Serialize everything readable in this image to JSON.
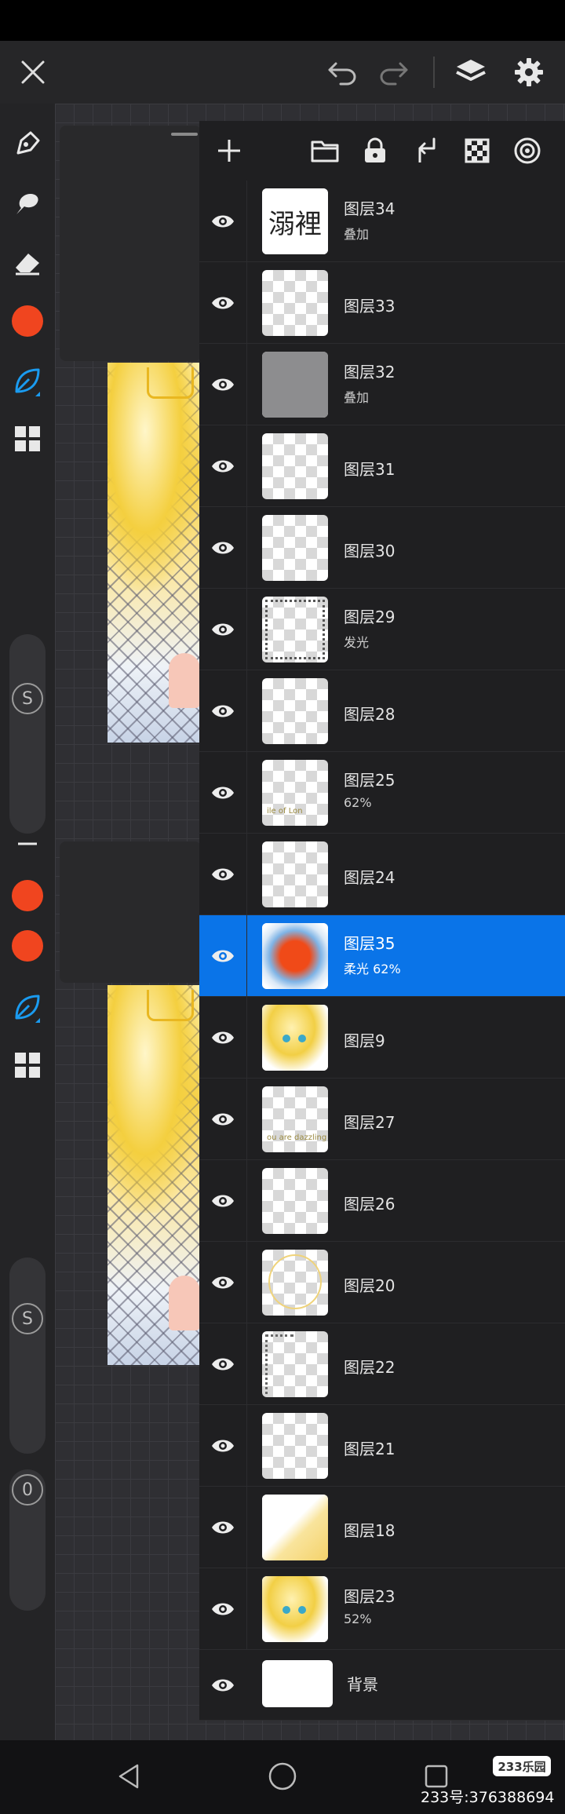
{
  "colors": {
    "accent": "#0a74e8",
    "brush_color": "#f0451f",
    "panel_bg": "#1f1f21",
    "toolbar_bg": "#242426"
  },
  "top_bar": {
    "icons": [
      "close-icon",
      "undo-icon",
      "redo-icon",
      "layers-icon",
      "settings-icon"
    ]
  },
  "toolbar": {
    "icons": [
      "pen-icon",
      "smudge-icon",
      "eraser-icon",
      "color-swatch",
      "brush-leaf-icon",
      "grid-icon"
    ],
    "slider_labels": [
      "S",
      "S",
      "0"
    ]
  },
  "layers_panel": {
    "header_icons": [
      "add-icon",
      "folder-icon",
      "lock-icon",
      "merge-down-icon",
      "checker-icon",
      "target-icon"
    ],
    "layers": [
      {
        "name": "图层34",
        "mode": "叠加",
        "thumb": "text",
        "thumb_text": "溺裡"
      },
      {
        "name": "图层33",
        "mode": "",
        "thumb": "empty"
      },
      {
        "name": "图层32",
        "mode": "叠加",
        "thumb": "grey"
      },
      {
        "name": "图层31",
        "mode": "",
        "thumb": "empty"
      },
      {
        "name": "图层30",
        "mode": "",
        "thumb": "empty"
      },
      {
        "name": "图层29",
        "mode": "发光",
        "thumb": "noise"
      },
      {
        "name": "图层28",
        "mode": "",
        "thumb": "empty"
      },
      {
        "name": "图层25",
        "mode": "62%",
        "thumb": "scribble",
        "thumb_text": "ile of Lon"
      },
      {
        "name": "图层24",
        "mode": "",
        "thumb": "empty"
      },
      {
        "name": "图层35",
        "mode": "柔光  62%",
        "thumb": "glow",
        "selected": true
      },
      {
        "name": "图层9",
        "mode": "",
        "thumb": "char"
      },
      {
        "name": "图层27",
        "mode": "",
        "thumb": "scribble",
        "thumb_text": "ou are dazzling"
      },
      {
        "name": "图层26",
        "mode": "",
        "thumb": "empty"
      },
      {
        "name": "图层20",
        "mode": "",
        "thumb": "ring"
      },
      {
        "name": "图层22",
        "mode": "",
        "thumb": "side"
      },
      {
        "name": "图层21",
        "mode": "",
        "thumb": "empty"
      },
      {
        "name": "图层18",
        "mode": "",
        "thumb": "yellow"
      },
      {
        "name": "图层23",
        "mode": "52%",
        "thumb": "char"
      }
    ],
    "background_layer": {
      "name": "背景"
    }
  },
  "watermark": {
    "logo": "233乐园",
    "text": "233号:376388694"
  }
}
